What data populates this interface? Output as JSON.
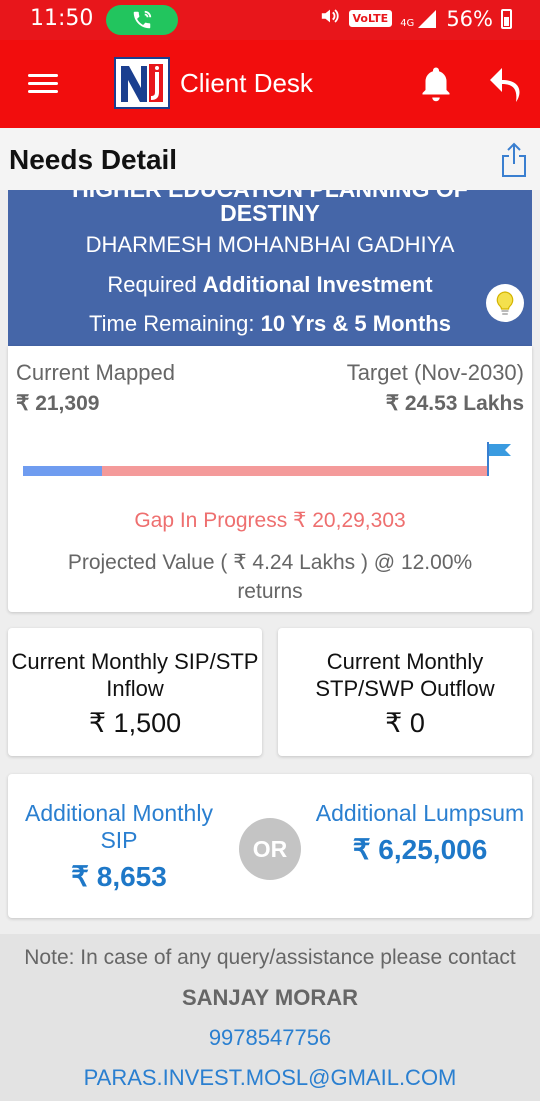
{
  "status_bar": {
    "time": "11:50",
    "network": "4G",
    "volte": "VoLTE",
    "battery": "56%"
  },
  "app_bar": {
    "title": "Client Desk",
    "logo_text": "Nj"
  },
  "header": {
    "title": "Needs Detail"
  },
  "goal": {
    "name_cut": "HIGHER EDUCATION PLANNING OF",
    "name_line2": "DESTINY",
    "client": "DHARMESH MOHANBHAI GADHIYA",
    "required_prefix": "Required ",
    "required_bold": "Additional Investment",
    "time_prefix": "Time Remaining: ",
    "time_value": "10 Yrs & 5 Months"
  },
  "progress": {
    "current_label": "Current Mapped",
    "current_value": "₹ 21,309",
    "target_label": "Target (Nov-2030)",
    "target_value": "₹ 24.53 Lakhs",
    "mapped_fraction": 0.17,
    "gap_text": "Gap In Progress ₹ 20,29,303",
    "projected_text": "Projected Value ( ₹ 4.24 Lakhs ) @ 12.00% returns"
  },
  "inflow": {
    "label": "Current Monthly SIP/STP Inflow",
    "value": "₹ 1,500"
  },
  "outflow": {
    "label": "Current Monthly STP/SWP Outflow",
    "value": "₹ 0"
  },
  "additional": {
    "sip_label": "Additional Monthly SIP",
    "sip_value": "₹ 8,653",
    "or_text": "OR",
    "lumpsum_label": "Additional Lumpsum",
    "lumpsum_value": "₹ 6,25,006"
  },
  "footer": {
    "note": "Note: In case of any query/assistance please contact",
    "name": "SANJAY MORAR",
    "phone": "9978547756",
    "email": "PARAS.INVEST.MOSL@GMAIL.COM"
  },
  "colors": {
    "app_bar": "#f20d0d",
    "banner": "#4566a8",
    "bar_mapped": "#6f9cf0",
    "bar_gap": "#f49a9a",
    "link": "#2a7fd0"
  }
}
